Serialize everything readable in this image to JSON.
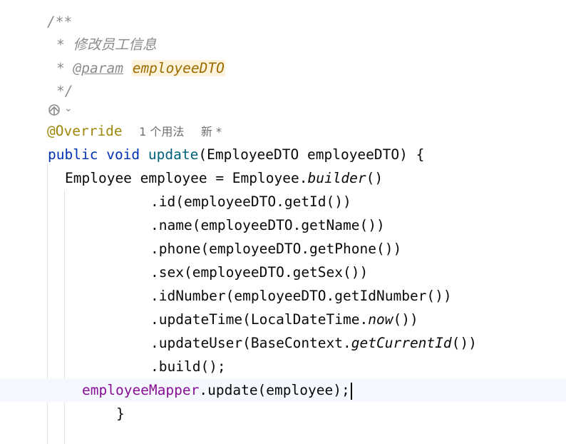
{
  "doc_comment": {
    "open": "/**",
    "star": "*",
    "description": "修改员工信息",
    "param_tag": "@param",
    "param_name": "employeeDTO",
    "close": "*/"
  },
  "gutter": {
    "icon": "implementation-gutter-icon",
    "chevron": "⌄"
  },
  "annotation": "@Override",
  "inlay_hints": {
    "usages": "1 个用法",
    "new": "新 *"
  },
  "code": {
    "kw_public": "public",
    "kw_void": "void",
    "method_name": "update",
    "params": "(EmployeeDTO employeeDTO) {",
    "builder_prefix": "Employee employee = Employee.",
    "builder_call": "builder",
    "builder_suffix": "()",
    "chain_id": ".id(employeeDTO.getId())",
    "chain_name": ".name(employeeDTO.getName())",
    "chain_phone": ".phone(employeeDTO.getPhone())",
    "chain_sex": ".sex(employeeDTO.getSex())",
    "chain_idnumber": ".idNumber(employeeDTO.getIdNumber())",
    "chain_updatetime_prefix": ".updateTime(LocalDateTime.",
    "chain_updatetime_call": "now",
    "chain_updatetime_suffix": "())",
    "chain_updateuser_prefix": ".updateUser(BaseContext.",
    "chain_updateuser_call": "getCurrentId",
    "chain_updateuser_suffix": "())",
    "chain_build": ".build();",
    "mapper_field": "employeeMapper",
    "mapper_call": ".update(employee);",
    "closing_brace": "}"
  },
  "colors": {
    "keyword": "#0033b3",
    "annotation": "#9e880d",
    "method": "#00627a",
    "field": "#871094",
    "comment": "#8c8c8c",
    "current_line": "#f5f8fe"
  }
}
